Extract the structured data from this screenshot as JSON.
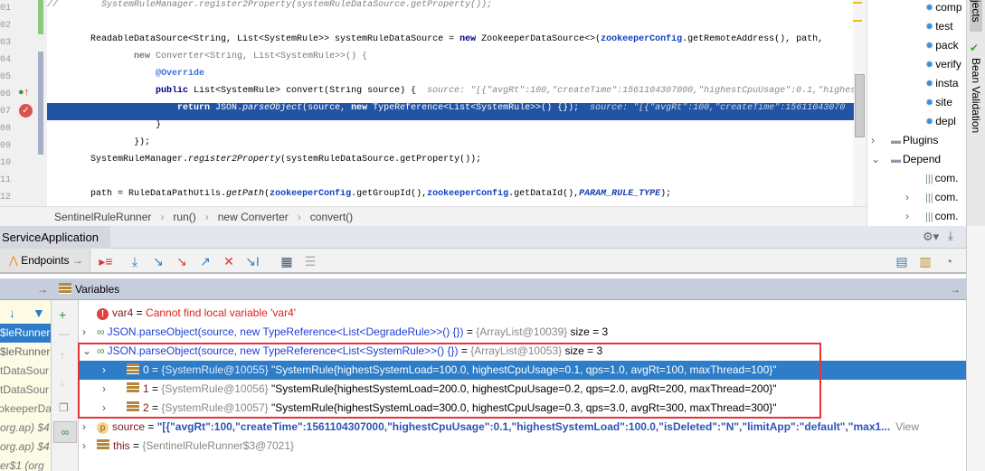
{
  "editor": {
    "line_numbers": [
      "01",
      "02",
      "03",
      "04",
      "05",
      "06",
      "07",
      "08",
      "09",
      "10",
      "11",
      "12"
    ],
    "lines": [
      [
        [
          "//        ",
          "cmt"
        ],
        [
          "SystemRuleManager.register2Property(systemRuleDataSource.getProperty());",
          "cmt"
        ]
      ],
      [],
      [
        [
          "        ReadableDataSource<String, List<SystemRule>> systemRuleDataSource = ",
          ""
        ],
        [
          "new",
          "kw"
        ],
        [
          " ZookeeperDataSource<>(",
          ""
        ],
        [
          "zookeeperConfig",
          "fld"
        ],
        [
          ".getRemoteAddress(), path,",
          ""
        ]
      ],
      [
        [
          "                ",
          ""
        ],
        [
          "new",
          "kw gr"
        ],
        [
          " Converter<String, List<SystemRule>>() {",
          "gr"
        ]
      ],
      [
        [
          "                    ",
          ""
        ],
        [
          "@Override",
          "ann"
        ]
      ],
      [
        [
          "                    ",
          ""
        ],
        [
          "public",
          "kw"
        ],
        [
          " List<SystemRule> convert(String source) {  ",
          ""
        ],
        [
          "source: \"[{\"avgRt\":100,\"createTime\":1561104307000,\"highestCpuUsage\":0.1,\"highest",
          "hint"
        ]
      ],
      [
        [
          "                        ",
          ""
        ],
        [
          "return",
          "kw"
        ],
        [
          " JSON.",
          ""
        ],
        [
          "parseObject",
          "it"
        ],
        [
          "(source, ",
          ""
        ],
        [
          "new",
          "kw"
        ],
        [
          " TypeReference<List<SystemRule>>() {});  ",
          ""
        ],
        [
          "source: \"[{\"avgRt\":100,\"createTime\":15611043070",
          "hint"
        ]
      ],
      [
        [
          "                    }",
          ""
        ]
      ],
      [
        [
          "                });",
          ""
        ]
      ],
      [
        [
          "        SystemRuleManager.",
          ""
        ],
        [
          "register2Property",
          "it"
        ],
        [
          "(systemRuleDataSource.getProperty());",
          ""
        ]
      ],
      [],
      [
        [
          "        path = RuleDataPathUtils.",
          ""
        ],
        [
          "getPath",
          "it"
        ],
        [
          "(",
          ""
        ],
        [
          "zookeeperConfig",
          "fld"
        ],
        [
          ".getGroupId(),",
          ""
        ],
        [
          "zookeeperConfig",
          "fld"
        ],
        [
          ".getDataId(),",
          ""
        ],
        [
          "PARAM_RULE_TYPE",
          "cst"
        ],
        [
          ");",
          ""
        ]
      ]
    ]
  },
  "breadcrumb": [
    "SentinelRuleRunner",
    "run()",
    "new Converter",
    "convert()"
  ],
  "project": {
    "items": [
      {
        "label": "comp",
        "icon": "gear-icon",
        "indent": 2
      },
      {
        "label": "test",
        "icon": "gear-icon",
        "indent": 2
      },
      {
        "label": "pack",
        "icon": "gear-icon",
        "indent": 2
      },
      {
        "label": "verify",
        "icon": "gear-icon",
        "indent": 2
      },
      {
        "label": "insta",
        "icon": "gear-icon",
        "indent": 2
      },
      {
        "label": "site",
        "icon": "gear-icon",
        "indent": 2
      },
      {
        "label": "depl",
        "icon": "gear-icon",
        "indent": 2
      },
      {
        "label": "Plugins",
        "icon": "folder-icon",
        "indent": 1,
        "arrow": "›"
      },
      {
        "label": "Depend",
        "icon": "folder-icon",
        "indent": 1,
        "arrow": "⌄"
      },
      {
        "label": "com.",
        "icon": "library-icon",
        "indent": 2
      },
      {
        "label": "com.",
        "icon": "library-icon",
        "indent": 2,
        "arrow": "›"
      },
      {
        "label": "com.",
        "icon": "library-icon",
        "indent": 2,
        "arrow": "›"
      }
    ]
  },
  "side_strip": {
    "projects": "jects",
    "bean_validation": "Bean Validation"
  },
  "debug": {
    "tab": "ServiceApplication",
    "endpoints": "Endpoints",
    "variables_title": "Variables",
    "frames": [
      "leRunner$",
      "leRunner$",
      "tDataSour",
      "tDataSour",
      "okeeperDa",
      "$4 (org.ap",
      "$4 (org.ap",
      "er$1 (org"
    ],
    "variables": [
      {
        "name": "var4",
        "eq": " = ",
        "value": "Cannot find local variable 'var4'",
        "type": "error"
      },
      {
        "name": "JSON.parseObject(source, new TypeReference<List<DegradeRule>>() {})",
        "eq": " = ",
        "ref": "{ArrayList@10039}",
        "extra": "  size = 3",
        "type": "watch",
        "expanded": false
      },
      {
        "name": "JSON.parseObject(source, new TypeReference<List<SystemRule>>() {})",
        "eq": " = ",
        "ref": "{ArrayList@10053}",
        "extra": "  size = 3",
        "type": "watch",
        "expanded": true
      },
      {
        "name": "0",
        "eq": " = ",
        "ref": "{SystemRule@10055}",
        "extra": " \"SystemRule{highestSystemLoad=100.0, highestCpuUsage=0.1, qps=1.0, avgRt=100, maxThread=100}\"",
        "type": "child",
        "selected": true
      },
      {
        "name": "1",
        "eq": " = ",
        "ref": "{SystemRule@10056}",
        "extra": " \"SystemRule{highestSystemLoad=200.0, highestCpuUsage=0.2, qps=2.0, avgRt=200, maxThread=200}\"",
        "type": "child"
      },
      {
        "name": "2",
        "eq": " = ",
        "ref": "{SystemRule@10057}",
        "extra": " \"SystemRule{highestSystemLoad=300.0, highestCpuUsage=0.3, qps=3.0, avgRt=300, maxThread=300}\"",
        "type": "child"
      },
      {
        "name": "source",
        "eq": " = ",
        "value": "\"[{\"avgRt\":100,\"createTime\":1561104307000,\"highestCpuUsage\":0.1,\"highestSystemLoad\":100.0,\"isDeleted\":\"N\",\"limitApp\":\"default\",\"max1...",
        "link": "View",
        "type": "param"
      },
      {
        "name": "this",
        "eq": " = ",
        "ref": "{SentinelRuleRunner$3@7021}",
        "type": "object"
      }
    ]
  },
  "colors": {
    "selection": "#2d7dc8",
    "editor_highlight": "#2154a5",
    "highlight_box": "#e8323a"
  }
}
